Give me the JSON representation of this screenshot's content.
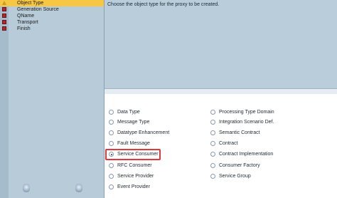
{
  "steps": [
    {
      "label": "Object Type",
      "status": "warning-icon",
      "active": true
    },
    {
      "label": "Generation Source",
      "status": "error-icon",
      "active": false
    },
    {
      "label": "QName",
      "status": "error-icon",
      "active": false
    },
    {
      "label": "Transport",
      "status": "error-icon",
      "active": false
    },
    {
      "label": "Finish",
      "status": "error-icon",
      "active": false
    }
  ],
  "description": "Choose the object type for the proxy to be created.",
  "options": {
    "col1": [
      {
        "label": "Data Type",
        "checked": false
      },
      {
        "label": "Message Type",
        "checked": false
      },
      {
        "label": "Datatype Enhancement",
        "checked": false
      },
      {
        "label": "Fault Message",
        "checked": false
      },
      {
        "label": "Service Consumer",
        "checked": true
      },
      {
        "label": "RFC Consumer",
        "checked": false
      },
      {
        "label": "Service Provider",
        "checked": false
      },
      {
        "label": "Event Provider",
        "checked": false
      }
    ],
    "col2": [
      {
        "label": "Processing Type Domain",
        "checked": false
      },
      {
        "label": "Integration Scenario Def.",
        "checked": false
      },
      {
        "label": "Semantic Contract",
        "checked": false
      },
      {
        "label": "Contract",
        "checked": false
      },
      {
        "label": "Contract Implementation",
        "checked": false
      },
      {
        "label": "Consumer Factory",
        "checked": false
      },
      {
        "label": "Service Group",
        "checked": false
      }
    ]
  },
  "colors": {
    "active_step": "#f7c744",
    "highlight": "#e0393d",
    "panel": "#b8cbd8"
  }
}
